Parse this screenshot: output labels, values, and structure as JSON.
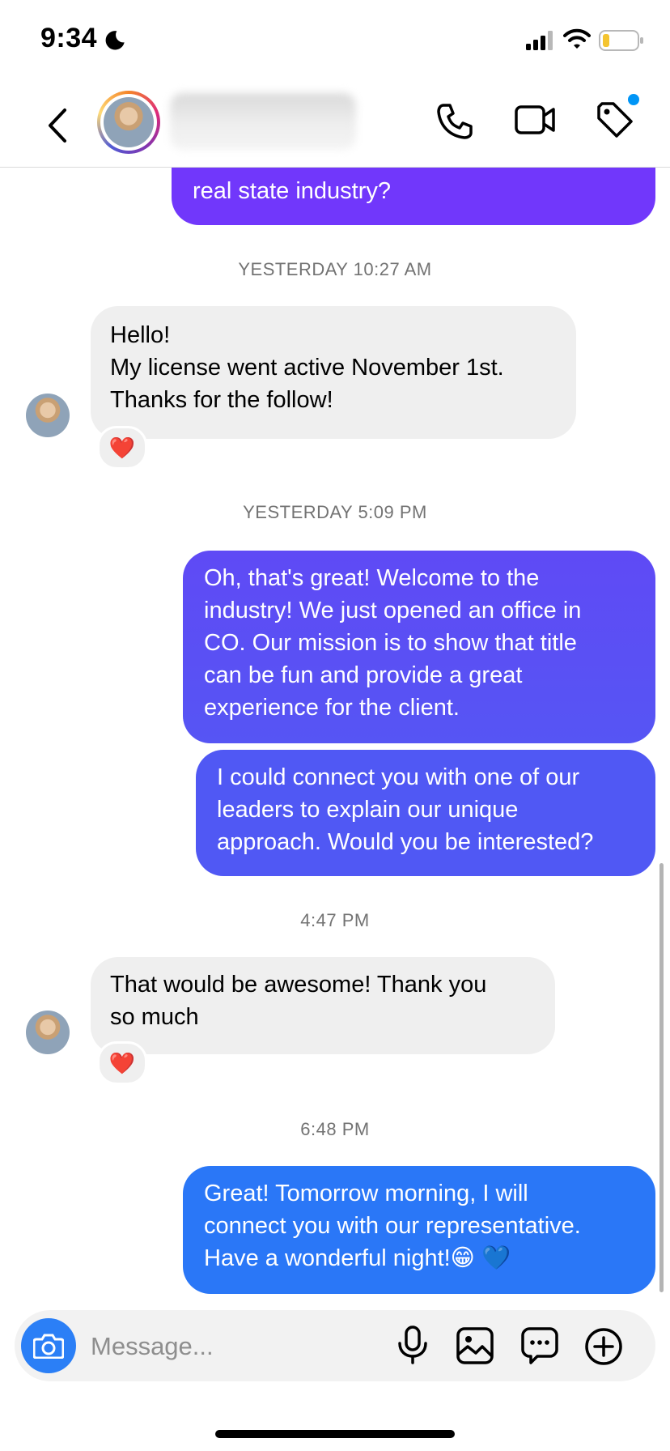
{
  "status_bar": {
    "time": "9:34"
  },
  "header": {
    "back_icon": "chevron-left-icon",
    "call_icon": "phone-icon",
    "video_icon": "video-camera-icon",
    "tag_icon": "tag-icon",
    "notification_color": "#0095f6"
  },
  "messages": [
    {
      "direction": "outgoing",
      "lines": [
        "real state industry?"
      ]
    },
    {
      "type": "timestamp",
      "text": "YESTERDAY 10:27 AM"
    },
    {
      "direction": "incoming",
      "lines": [
        "Hello!",
        "My license went active November 1st.",
        "Thanks for the follow!"
      ],
      "reaction": "❤️"
    },
    {
      "type": "timestamp",
      "text": "YESTERDAY 5:09 PM"
    },
    {
      "direction": "outgoing",
      "lines": [
        "Oh, that's great! Welcome to the",
        "industry! We just opened an office in",
        "CO. Our mission is to show that title",
        "can be fun and provide a great",
        "experience for the client."
      ]
    },
    {
      "direction": "outgoing",
      "lines": [
        "I could connect you with one of our",
        "leaders to explain our unique",
        "approach. Would you be interested?"
      ]
    },
    {
      "type": "timestamp",
      "text": "4:47 PM"
    },
    {
      "direction": "incoming",
      "lines": [
        "That would be awesome! Thank you",
        "so much"
      ],
      "reaction": "❤️"
    },
    {
      "type": "timestamp",
      "text": "6:48 PM"
    },
    {
      "direction": "outgoing",
      "lines": [
        "Great! Tomorrow morning, I will",
        "connect you with our representative.",
        "Have a wonderful night!😁 💙"
      ]
    }
  ],
  "composer": {
    "placeholder": "Message...",
    "camera_icon": "camera-icon",
    "mic_icon": "microphone-icon",
    "gallery_icon": "image-icon",
    "sticker_icon": "sticker-chat-icon",
    "add_icon": "plus-circle-icon"
  },
  "colors": {
    "outgoing_purple": "#7137fb",
    "outgoing_indigo": "#5058f4",
    "outgoing_blue": "#2a77f7",
    "incoming_bg": "#efefef",
    "accent": "#2b7ff6"
  }
}
